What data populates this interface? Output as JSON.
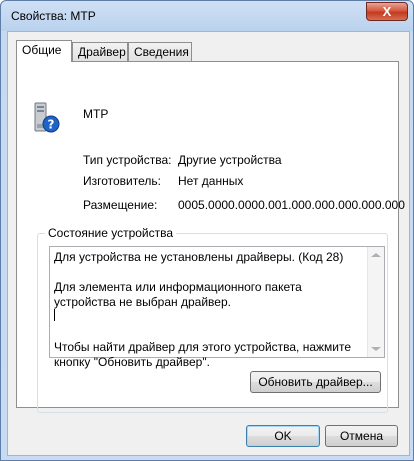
{
  "window": {
    "title": "Свойства: MTP",
    "close_label": "X"
  },
  "tabs": [
    {
      "label": "Общие"
    },
    {
      "label": "Драйвер"
    },
    {
      "label": "Сведения"
    }
  ],
  "device": {
    "name": "MTP",
    "icon": "unknown-device-icon",
    "properties": [
      {
        "label": "Тип устройства:",
        "value": "Другие устройства"
      },
      {
        "label": "Изготовитель:",
        "value": "Нет данных"
      },
      {
        "label": "Размещение:",
        "value": "0005.0000.0000.001.000.000.000.000.000"
      }
    ]
  },
  "status": {
    "group_label": "Состояние устройства",
    "text": "Для устройства не установлены драйверы. (Код 28)\n\nДля элемента или информационного пакета устройства не выбран драйвер.\n\n\nЧтобы найти драйвер для этого устройства, нажмите кнопку \"Обновить драйвер\".",
    "update_button": "Обновить драйвер..."
  },
  "footer": {
    "ok": "OK",
    "cancel": "Отмена"
  }
}
